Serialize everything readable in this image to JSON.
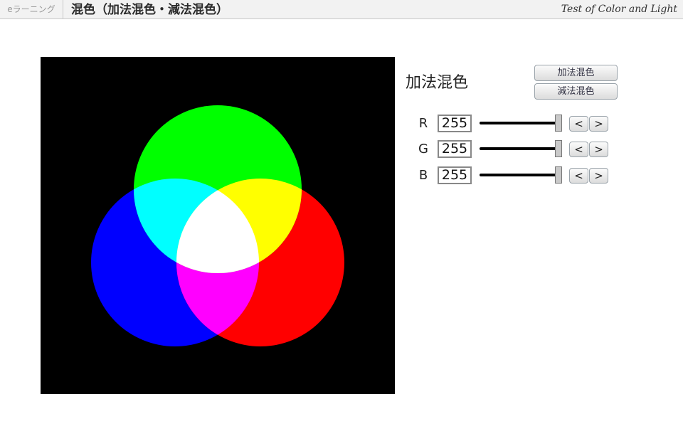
{
  "header": {
    "brand": "eラーニング",
    "title": "混色（加法混色・減法混色）",
    "subtitle": "Test of Color and Light"
  },
  "panel": {
    "mode_label": "加法混色",
    "mode_buttons": {
      "additive": "加法混色",
      "subtractive": "減法混色"
    },
    "channels": [
      {
        "name": "R",
        "value": "255",
        "level": 1.0,
        "dec": "<",
        "inc": ">"
      },
      {
        "name": "G",
        "value": "255",
        "level": 1.0,
        "dec": "<",
        "inc": ">"
      },
      {
        "name": "B",
        "value": "255",
        "level": 1.0,
        "dec": "<",
        "inc": ">"
      }
    ]
  },
  "colors": {
    "red": "#ff0000",
    "green": "#00ff00",
    "blue": "#0000ff",
    "cyan": "#00ffff",
    "magenta": "#ff00ff",
    "yellow": "#ffff00",
    "white": "#ffffff",
    "background": "#000000"
  }
}
